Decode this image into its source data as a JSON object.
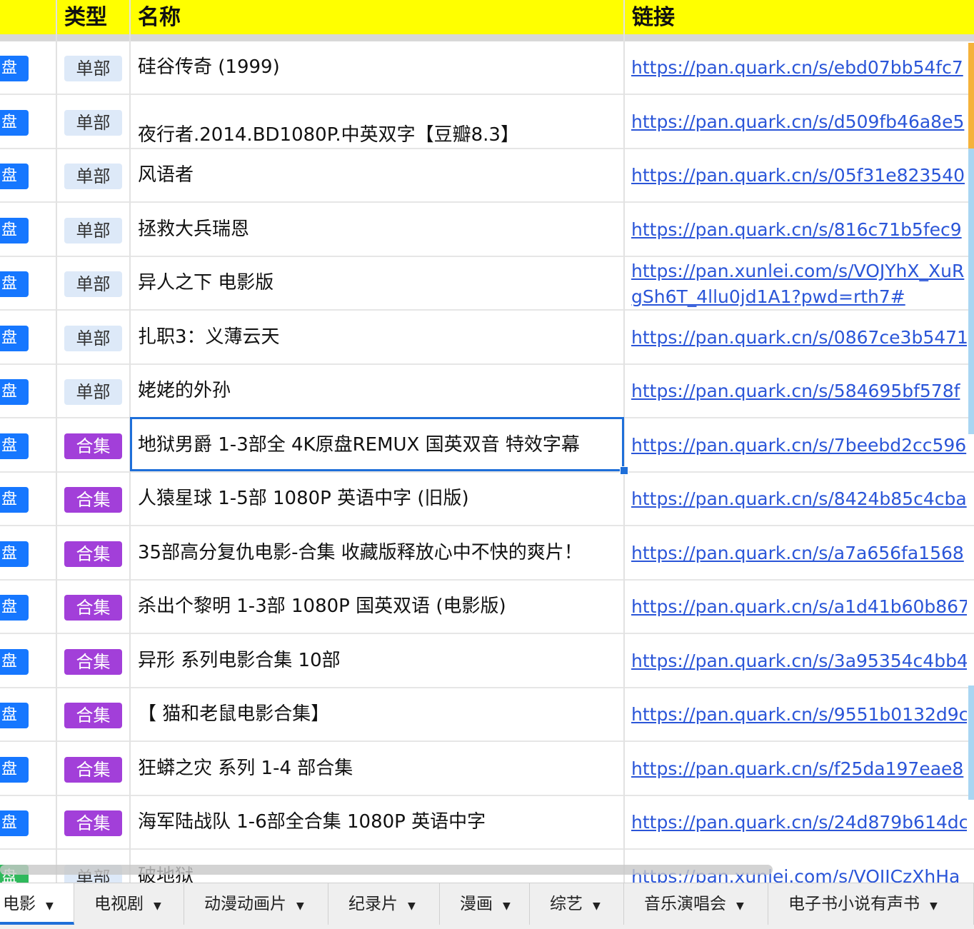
{
  "header": {
    "col_type": "类型",
    "col_name": "名称",
    "col_link": "链接"
  },
  "rows": [
    {
      "source": "盘",
      "type": "单部",
      "kind": "single",
      "name": "硅谷传奇 (1999)",
      "link": "https://pan.quark.cn/s/ebd07bb54fc7"
    },
    {
      "source": "盘",
      "type": "单部",
      "kind": "single",
      "name": "夜行者.2014.BD1080P.中英双字【豆瓣8.3】",
      "link": "https://pan.quark.cn/s/d509fb46a8e5"
    },
    {
      "source": "盘",
      "type": "单部",
      "kind": "single",
      "name": "风语者",
      "link": "https://pan.quark.cn/s/05f31e823540"
    },
    {
      "source": "盘",
      "type": "单部",
      "kind": "single",
      "name": "拯救大兵瑞恩",
      "link": "https://pan.quark.cn/s/816c71b5fec9"
    },
    {
      "source": "盘",
      "type": "单部",
      "kind": "single",
      "name": "异人之下 电影版",
      "link": "https://pan.xunlei.com/s/VOJYhX_XuRgSh6T_4llu0jd1A1?pwd=rth7#"
    },
    {
      "source": "盘",
      "type": "单部",
      "kind": "single",
      "name": "扎职3：义薄云天",
      "link": "https://pan.quark.cn/s/0867ce3b5471"
    },
    {
      "source": "盘",
      "type": "单部",
      "kind": "single",
      "name": "姥姥的外孙",
      "link": "https://pan.quark.cn/s/584695bf578f"
    },
    {
      "source": "盘",
      "type": "合集",
      "kind": "collection",
      "name": "地狱男爵 1-3部全 4K原盘REMUX 国英双音 特效字幕",
      "link": "https://pan.quark.cn/s/7beebd2cc596"
    },
    {
      "source": "盘",
      "type": "合集",
      "kind": "collection",
      "name": "人猿星球 1-5部 1080P 英语中字 (旧版)",
      "link": "https://pan.quark.cn/s/8424b85c4cba"
    },
    {
      "source": "盘",
      "type": "合集",
      "kind": "collection",
      "name": "35部高分复仇电影-合集 收藏版释放心中不快的爽片！",
      "link": "https://pan.quark.cn/s/a7a656fa1568"
    },
    {
      "source": "盘",
      "type": "合集",
      "kind": "collection",
      "name": "杀出个黎明 1-3部 1080P 国英双语 (电影版)",
      "link": "https://pan.quark.cn/s/a1d41b60b867"
    },
    {
      "source": "盘",
      "type": "合集",
      "kind": "collection",
      "name": "异形 系列电影合集 10部",
      "link": "https://pan.quark.cn/s/3a95354c4bb4"
    },
    {
      "source": "盘",
      "type": "合集",
      "kind": "collection",
      "name": "【 猫和老鼠电影合集】",
      "link": "https://pan.quark.cn/s/9551b0132d9c"
    },
    {
      "source": "盘",
      "type": "合集",
      "kind": "collection",
      "name": "狂蟒之灾 系列 1-4 部合集",
      "link": "https://pan.quark.cn/s/f25da197eae8"
    },
    {
      "source": "盘",
      "type": "合集",
      "kind": "collection",
      "name": "海军陆战队 1-6部全合集 1080P 英语中字",
      "link": "https://pan.quark.cn/s/24d879b614dc"
    },
    {
      "source": "盘",
      "type": "单部",
      "kind": "single",
      "name": "破地狱",
      "link": "https://pan.xunlei.com/s/VOJJCzXhHa"
    }
  ],
  "tabs": [
    {
      "label": "电影",
      "active": true
    },
    {
      "label": "电视剧"
    },
    {
      "label": "动漫动画片"
    },
    {
      "label": "纪录片"
    },
    {
      "label": "漫画"
    },
    {
      "label": "综艺"
    },
    {
      "label": "音乐演唱会"
    },
    {
      "label": "电子书小说有声书"
    }
  ],
  "icons": {
    "tab_dropdown": "caret-down-icon"
  },
  "colors": {
    "header_bg": "#ffff00",
    "single_tag": "#dde9f8",
    "collection_tag": "#a23fd9",
    "source_badge": "#1677ff",
    "link": "#2a55d8",
    "selection": "#1e6fd9"
  }
}
